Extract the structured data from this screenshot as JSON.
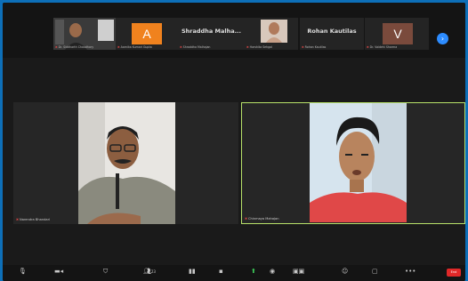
{
  "gallery": [
    {
      "name": "Dr. Siddharth Chaudhary",
      "kind": "video"
    },
    {
      "name": "Aarnika Kumari Gupta",
      "kind": "letter",
      "letter": "A",
      "color": "#f0821e"
    },
    {
      "name": "Shraddha Malhajan",
      "kind": "text",
      "big": "Shraddha Malha..."
    },
    {
      "name": "Harshita Sehgal",
      "kind": "video"
    },
    {
      "name": "Rohan Kautilas",
      "kind": "text",
      "big": "Rohan Kautilas"
    },
    {
      "name": "Dr. Vaidehi Sharma",
      "kind": "letter",
      "letter": "V",
      "color": "#7a4a3c"
    }
  ],
  "gallery_next_icon": "chevron-right-icon",
  "main": {
    "left_label": "Narendra Bhandari",
    "right_label": "Chinmaya Mahajan",
    "active_speaker_color": "#b8e26a"
  },
  "toolbar": {
    "participants_count": "23",
    "end_label": "End",
    "icons": [
      "mic-icon",
      "video-icon",
      "security-icon",
      "participants-icon",
      "polls-icon",
      "chat-icon",
      "share-screen-icon",
      "record-icon",
      "breakout-icon",
      "reactions-icon",
      "apps-icon",
      "more-icon",
      "end-button"
    ]
  }
}
